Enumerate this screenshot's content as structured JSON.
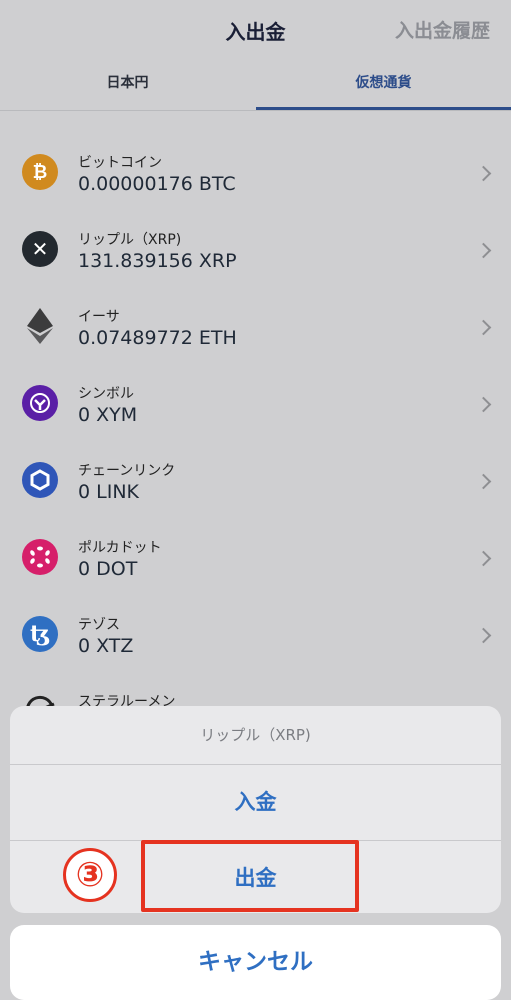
{
  "header": {
    "title": "入出金",
    "history_link": "入出金履歴"
  },
  "tabs": [
    {
      "label": "日本円"
    },
    {
      "label": "仮想通貨"
    }
  ],
  "coins": [
    {
      "name": "ビットコイン",
      "amount": "0.00000176 BTC",
      "icon": "bitcoin-icon",
      "color": "#d08a1f"
    },
    {
      "name": "リップル（XRP)",
      "amount": "131.839156 XRP",
      "icon": "xrp-icon",
      "color": "#23292f"
    },
    {
      "name": "イーサ",
      "amount": "0.07489772 ETH",
      "icon": "ethereum-icon",
      "color": "#3c3c3d"
    },
    {
      "name": "シンボル",
      "amount": "0 XYM",
      "icon": "symbol-icon",
      "color": "#5a1fa6"
    },
    {
      "name": "チェーンリンク",
      "amount": "0 LINK",
      "icon": "chainlink-icon",
      "color": "#2f56b8"
    },
    {
      "name": "ポルカドット",
      "amount": "0 DOT",
      "icon": "polkadot-icon",
      "color": "#d61f6a"
    },
    {
      "name": "テゾス",
      "amount": "0 XTZ",
      "icon": "tezos-icon",
      "color": "#2f6fc2"
    },
    {
      "name": "ステラルーメン",
      "amount": "",
      "icon": "stellar-icon",
      "color": "#222222"
    }
  ],
  "action_sheet": {
    "title": "リップル（XRP)",
    "deposit": "入金",
    "withdraw": "出金",
    "cancel": "キャンセル"
  },
  "annotation": {
    "step_marker": "③",
    "highlight_color": "#e53320"
  }
}
